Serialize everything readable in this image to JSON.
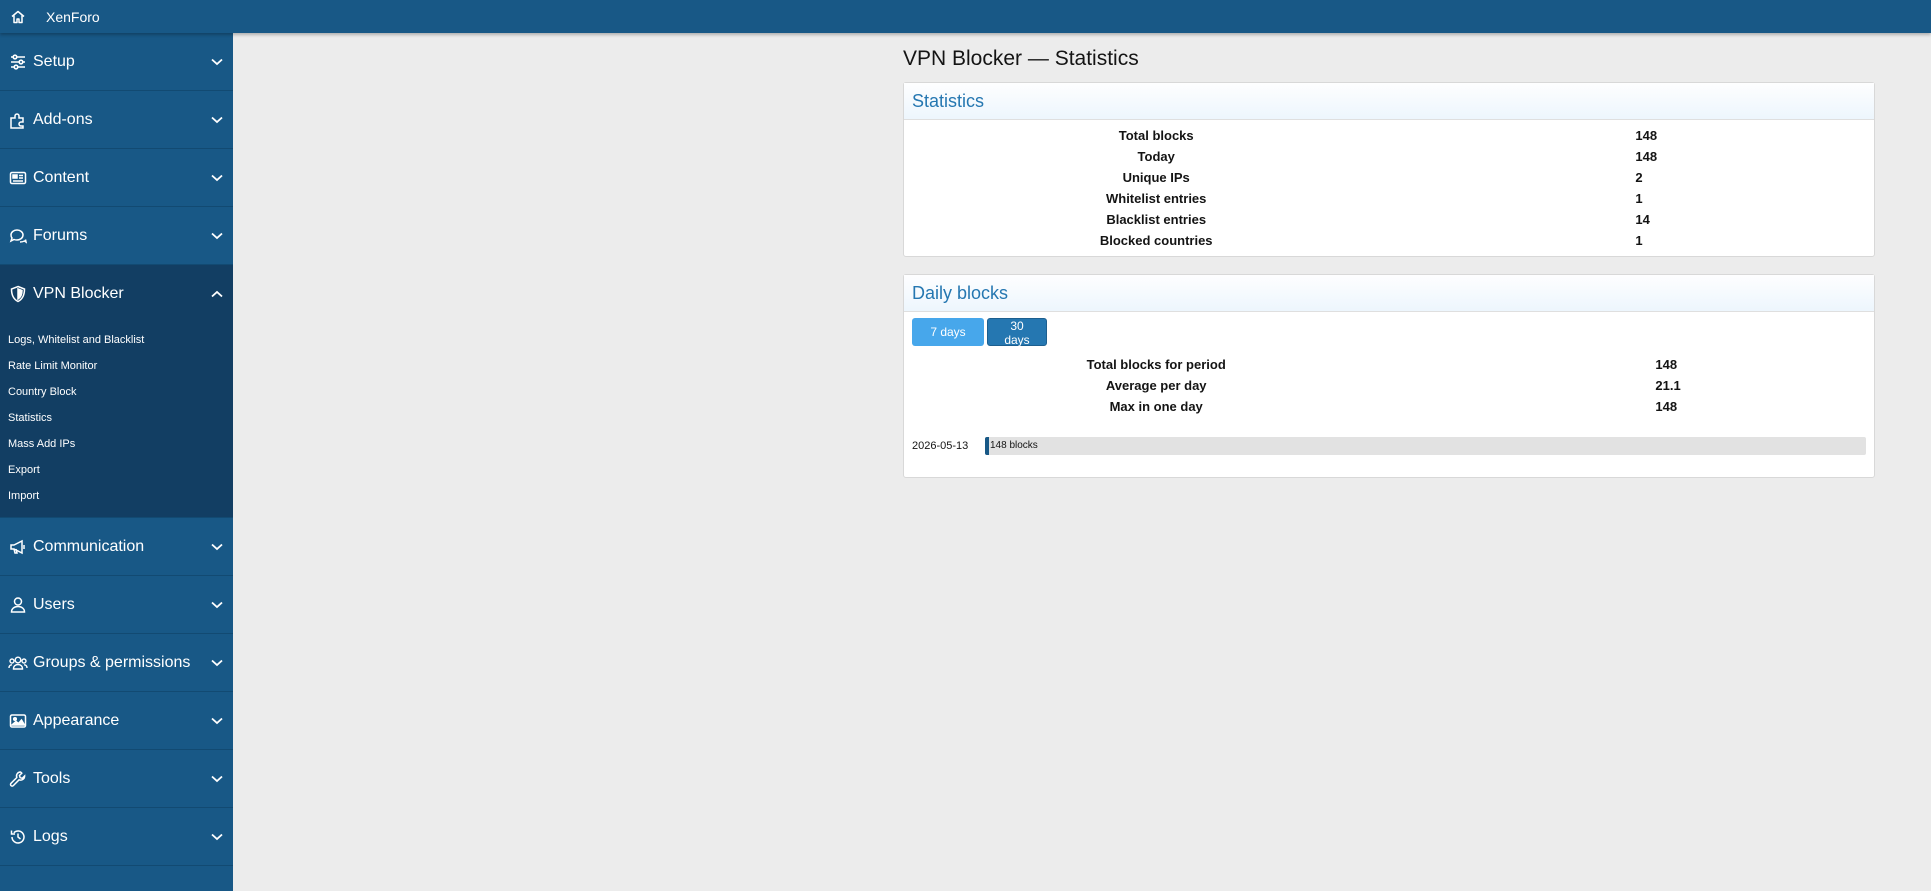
{
  "topbar": {
    "brand": "XenForo"
  },
  "sidebar": {
    "sections": [
      {
        "label": "Setup",
        "icon": "sliders-icon"
      },
      {
        "label": "Add-ons",
        "icon": "puzzle-icon"
      },
      {
        "label": "Content",
        "icon": "newspaper-icon"
      },
      {
        "label": "Forums",
        "icon": "comments-icon"
      },
      {
        "label": "VPN Blocker",
        "icon": "shield-icon",
        "open": true,
        "items": [
          "Logs, Whitelist and Blacklist",
          "Rate Limit Monitor",
          "Country Block",
          "Statistics",
          "Mass Add IPs",
          "Export",
          "Import"
        ]
      },
      {
        "label": "Communication",
        "icon": "megaphone-icon"
      },
      {
        "label": "Users",
        "icon": "user-icon"
      },
      {
        "label": "Groups & permissions",
        "icon": "users-icon"
      },
      {
        "label": "Appearance",
        "icon": "image-icon"
      },
      {
        "label": "Tools",
        "icon": "wrench-icon"
      },
      {
        "label": "Logs",
        "icon": "history-icon"
      }
    ]
  },
  "page": {
    "title": "VPN Blocker — Statistics"
  },
  "statistics": {
    "heading": "Statistics",
    "rows": [
      {
        "label": "Total blocks",
        "value": "148"
      },
      {
        "label": "Today",
        "value": "148"
      },
      {
        "label": "Unique IPs",
        "value": "2"
      },
      {
        "label": "Whitelist entries",
        "value": "1"
      },
      {
        "label": "Blacklist entries",
        "value": "14"
      },
      {
        "label": "Blocked countries",
        "value": "1"
      }
    ]
  },
  "daily": {
    "heading": "Daily blocks",
    "buttons": {
      "seven": "7 days",
      "thirty": "30 days"
    },
    "rows": [
      {
        "label": "Total blocks for period",
        "value": "148"
      },
      {
        "label": "Average per day",
        "value": "21.1"
      },
      {
        "label": "Max in one day",
        "value": "148"
      }
    ],
    "bars": [
      {
        "date": "2026-05-13",
        "label": "148 blocks",
        "fill_fraction": 0.005
      }
    ]
  },
  "colors": {
    "brand": "#185886",
    "accent": "#2577b1",
    "button_light": "#47a7eb"
  }
}
